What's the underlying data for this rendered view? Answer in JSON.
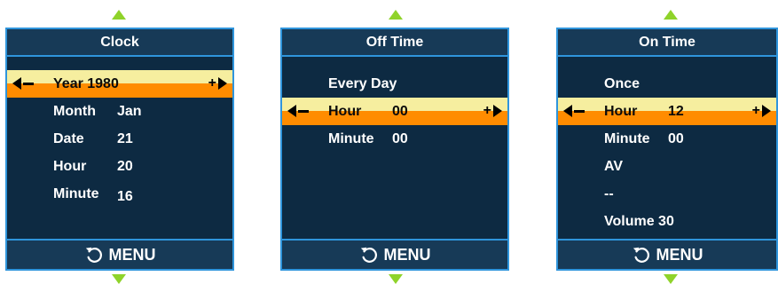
{
  "panels": [
    {
      "title": "Clock",
      "rows": [
        {
          "label": "Year 1980",
          "value": "",
          "selected": true
        },
        {
          "label": "Month",
          "value": "Jan"
        },
        {
          "label": "Date",
          "value": "21"
        },
        {
          "label": "Hour",
          "value": "20"
        },
        {
          "label": "Minute",
          "value": "16"
        }
      ],
      "footer": "MENU"
    },
    {
      "title": "Off Time",
      "rows": [
        {
          "label": "Every Day",
          "value": ""
        },
        {
          "label": "Hour",
          "value": "00",
          "selected": true
        },
        {
          "label": "Minute",
          "value": "00"
        }
      ],
      "footer": "MENU"
    },
    {
      "title": "On Time",
      "rows": [
        {
          "label": "Once",
          "value": ""
        },
        {
          "label": "Hour",
          "value": "12",
          "selected": true
        },
        {
          "label": "Minute",
          "value": "00"
        },
        {
          "label": "AV",
          "value": ""
        },
        {
          "label": "--",
          "value": ""
        },
        {
          "label": "Volume 30",
          "value": ""
        }
      ],
      "footer": "MENU"
    }
  ],
  "controls": {
    "decrease": "–",
    "increase": "+"
  },
  "icons": {
    "nav_up": "arrow-up-icon",
    "nav_down": "arrow-down-icon",
    "back": "return-icon"
  },
  "colors": {
    "background": "#0d2a42",
    "border": "#2f95dc",
    "highlight": "#ff8c00",
    "highlight_top": "#f6ee9f",
    "arrows": "#8fd32a"
  }
}
